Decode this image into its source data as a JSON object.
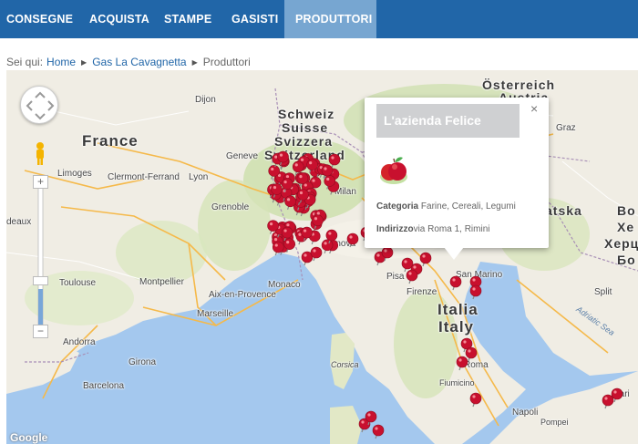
{
  "nav": {
    "items": [
      "CONSEGNE",
      "ACQUISTA",
      "STAMPE",
      "GASISTI",
      "PRODUTTORI"
    ],
    "active_index": 4
  },
  "breadcrumb": {
    "prefix": "Sei qui:",
    "items": [
      "Home",
      "Gas La Cavagnetta",
      "Produttori"
    ]
  },
  "map": {
    "labels": {
      "france": "France",
      "schweiz": "Schweiz",
      "suisse": "Suisse",
      "svizzera": "Svizzera",
      "switzerland": "Switzerland",
      "osterreich": "Österreich",
      "austria": "Austria",
      "italia": "Italia",
      "italy": "Italy",
      "dijon": "Dijon",
      "geneve": "Geneve",
      "limoges": "Limoges",
      "clermont": "Clermont-Ferrand",
      "lyon": "Lyon",
      "grenoble": "Grenoble",
      "deaux": "deaux",
      "toulouse": "Toulouse",
      "montpellier": "Montpellier",
      "monaco": "Monaco",
      "aix": "Aix-en-Provence",
      "marseille": "Marseille",
      "andorra": "Andorra",
      "girona": "Girona",
      "barcelona": "Barcelona",
      "milan": "Milan",
      "genova": "Genova",
      "pisa": "Pisa",
      "firenze": "Firenze",
      "sanmarino": "San Marino",
      "corsica": "Corsica",
      "roma": "Roma",
      "fiumicino": "Fiumicino",
      "napoli": "Napoli",
      "pompei": "Pompei",
      "bari": "Bari",
      "graz": "Graz",
      "split": "Split",
      "adriatic": "Adriatic Sea",
      "hrvatska": "atska",
      "bo": "Bo",
      "xe": "Хе",
      "xerc": "Херц",
      "bo2": "Бо",
      "google": "Google"
    },
    "controls": {
      "zoom_in": "+",
      "zoom_out": "−"
    }
  },
  "infowindow": {
    "title": "L'azienda Felice",
    "close": "×",
    "category_label": "Categoria",
    "category_value": "Farine, Cereali, Legumi",
    "address_label": "Indirizzo",
    "address_value": "via Roma 1, Rimini",
    "icon": "apple-icon"
  },
  "colors": {
    "nav_bg": "#2166a8",
    "nav_active": "#77a6d1",
    "marker": "#c8102e",
    "sea": "#a4c8ee",
    "land": "#f2efe6"
  }
}
